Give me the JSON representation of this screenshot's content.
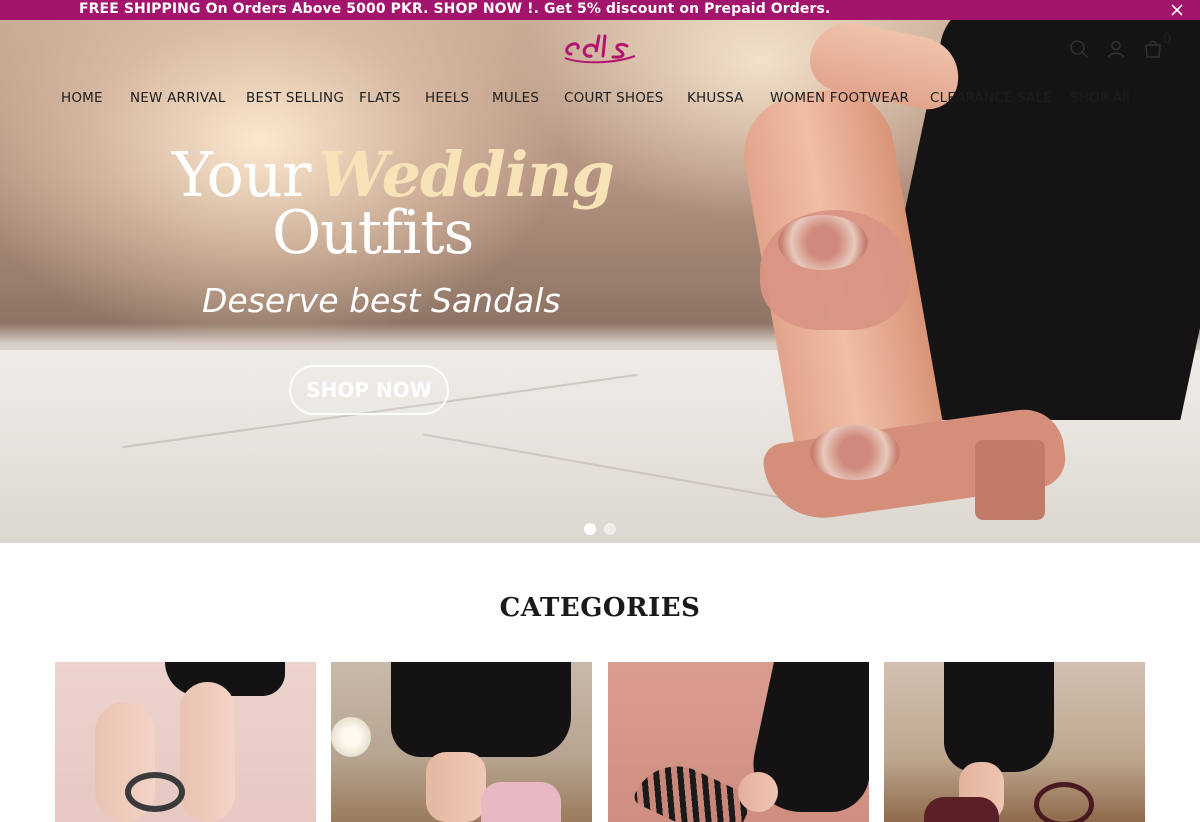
{
  "announcement": {
    "text": "FREE SHIPPING On Orders Above 5000 PKR. SHOP NOW !. Get 5% discount on Prepaid Orders."
  },
  "header": {
    "cart_count": "0"
  },
  "nav": {
    "items": [
      {
        "label": "HOME"
      },
      {
        "label": "NEW ARRIVAL"
      },
      {
        "label": "BEST SELLING"
      },
      {
        "label": "FLATS"
      },
      {
        "label": "HEELS"
      },
      {
        "label": "MULES"
      },
      {
        "label": "COURT SHOES"
      },
      {
        "label": "KHUSSA"
      },
      {
        "label": "WOMEN FOOTWEAR"
      },
      {
        "label": "CLEARANCE SALE"
      },
      {
        "label": "SHOP All"
      }
    ]
  },
  "hero": {
    "line1_plain": "Your",
    "line1_accent": "Wedding",
    "line2": "Outfits",
    "tagline": "Deserve best Sandals",
    "cta": "SHOP NOW",
    "slide_count": 2,
    "active_slide": 1
  },
  "categories": {
    "title": "CATEGORIES"
  },
  "colors": {
    "brand": "#a3156d",
    "announcement_text": "#ffffff",
    "accent_text": "#f7e3b7"
  }
}
